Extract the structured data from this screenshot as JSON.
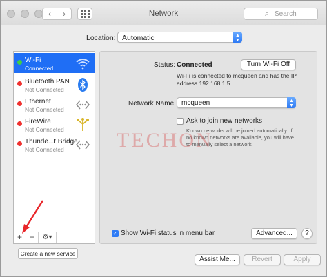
{
  "window": {
    "title": "Network"
  },
  "toolbar": {
    "back_glyph": "‹",
    "forward_glyph": "›",
    "search_placeholder": "Search",
    "search_icon": "magnifier-icon"
  },
  "location": {
    "label": "Location:",
    "value": "Automatic"
  },
  "services": [
    {
      "name": "Wi-Fi",
      "status": "Connected",
      "status_color": "#3fcf45",
      "icon": "wifi-icon",
      "selected": true
    },
    {
      "name": "Bluetooth PAN",
      "status": "Not Connected",
      "status_color": "#f0312f",
      "icon": "bluetooth-icon",
      "selected": false
    },
    {
      "name": "Ethernet",
      "status": "Not Connected",
      "status_color": "#f0312f",
      "icon": "ethernet-icon",
      "selected": false
    },
    {
      "name": "FireWire",
      "status": "Not Connected",
      "status_color": "#f0312f",
      "icon": "firewire-icon",
      "selected": false
    },
    {
      "name": "Thunde...t Bridge",
      "status": "Not Connected",
      "status_color": "#f0312f",
      "icon": "thunderbolt-bridge-icon",
      "selected": false
    }
  ],
  "sidebar_toolbar": {
    "add": "+",
    "remove": "−",
    "gear": "⚙▾"
  },
  "create_service_label": "Create a new service",
  "detail": {
    "status_label": "Status:",
    "status_value": "Connected",
    "turn_off_label": "Turn Wi-Fi Off",
    "status_description": "Wi-Fi is connected to mcqueen and has the IP address 192.168.1.5.",
    "network_name_label": "Network Name:",
    "network_name_value": "mcqueen",
    "ask_join_label": "Ask to join new networks",
    "ask_join_checked": false,
    "ask_join_description": "Known networks will be joined automatically. If no known networks are available, you will have to manually select a network.",
    "show_status_label": "Show Wi-Fi status in menu bar",
    "show_status_checked": true,
    "advanced_label": "Advanced...",
    "help_glyph": "?"
  },
  "footer": {
    "assist_label": "Assist Me...",
    "revert_label": "Revert",
    "apply_label": "Apply"
  },
  "watermark_text": "TECHON",
  "colors": {
    "accent": "#1f6ef5",
    "connected": "#3fcf45",
    "not_connected": "#f0312f",
    "annotation_arrow": "#e8262a"
  }
}
